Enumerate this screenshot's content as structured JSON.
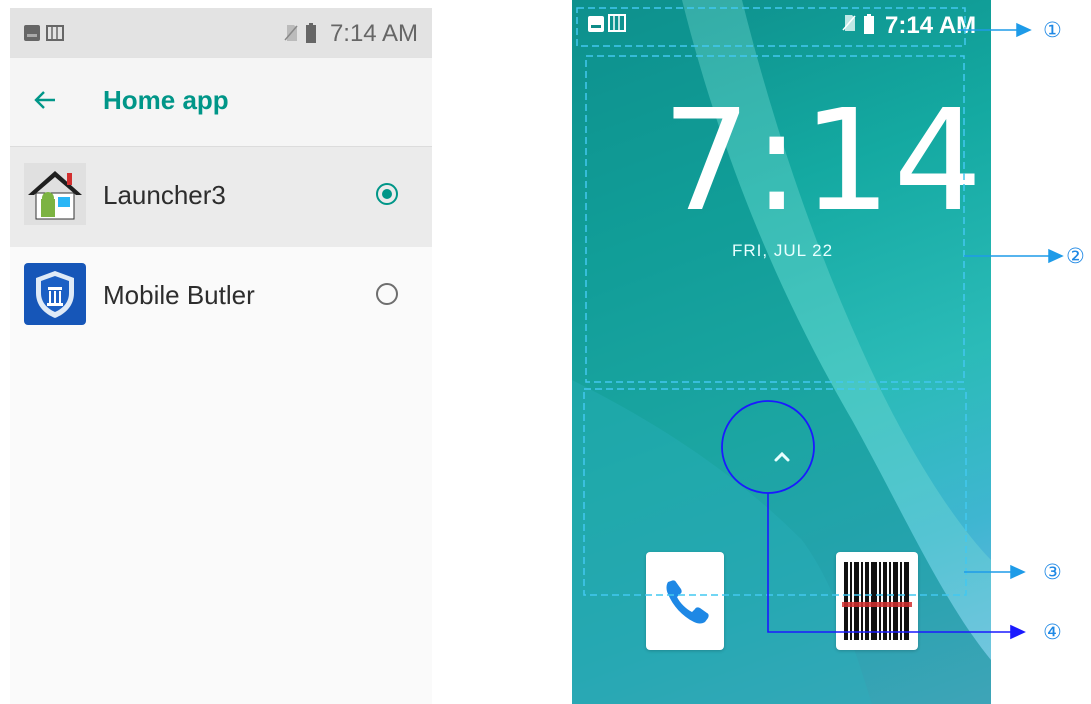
{
  "left_screen": {
    "status_bar": {
      "time": "7:14 AM",
      "icons": [
        "image-notification-icon",
        "sim-card-icon",
        "no-sim-icon",
        "battery-icon"
      ]
    },
    "toolbar": {
      "back_icon": "back-arrow-icon",
      "title": "Home app"
    },
    "apps": [
      {
        "label": "Launcher3",
        "icon": "launcher3-house-icon",
        "selected": true
      },
      {
        "label": "Mobile Butler",
        "icon": "mobile-butler-shield-icon",
        "selected": false
      }
    ],
    "colors": {
      "accent": "#009688"
    }
  },
  "right_screen": {
    "status_bar": {
      "time": "7:14 AM",
      "icons": [
        "image-notification-icon",
        "sim-card-icon",
        "no-sim-icon",
        "battery-icon"
      ]
    },
    "clock": "7:14",
    "date": "FRI, JUL 22",
    "swipe_up_icon": "chevron-up-icon",
    "dock": [
      {
        "name": "Phone",
        "icon": "phone-icon"
      },
      {
        "name": "Barcode scanner",
        "icon": "barcode-icon"
      }
    ]
  },
  "annotations": {
    "callouts": [
      "①",
      "②",
      "③",
      "④"
    ],
    "colors": {
      "dashed_box": "#42c8f0",
      "arrow": "#1e9be8",
      "circle": "#1a1aff"
    }
  }
}
